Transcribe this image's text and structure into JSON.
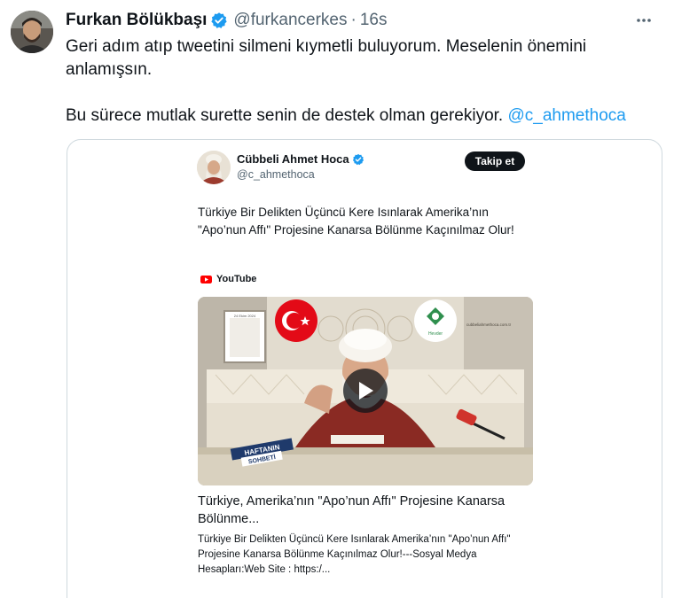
{
  "tweet": {
    "author_name": "Furkan Bölükbaşı",
    "handle": "@furkancerkes",
    "separator": "·",
    "time": "16s",
    "more_icon": "more-horizontal-icon",
    "verified_color": "#1d9bf0",
    "text_line1": "Geri adım atıp tweetini silmeni kıymetli buluyorum. Meselenin önemini anlamışsın.",
    "text_line2": "Bu sürece mutlak surette senin de destek olman gerekiyor.",
    "mention": "@c_ahmethoca",
    "mention_color": "#1d9bf0"
  },
  "embed": {
    "author_name": "Cübbeli Ahmet Hoca",
    "handle": "@c_ahmethoca",
    "follow_label": "Takip et",
    "text": "Türkiye Bir Delikten Üçüncü Kere Isınlarak Amerika’nın \"Apo’nun Affı\" Projesine Kanarsa Bölünme Kaçınılmaz Olur!",
    "source": "YouTube",
    "video": {
      "date_label": "24 Ekim 2024",
      "logo_label": "Hevder",
      "site_label": "cubbeliahmethoca.com.tr",
      "banner_line1": "HAFTANIN",
      "banner_line2": "SOHBETİ",
      "play_icon": "play-icon"
    },
    "card_title": "Türkiye, Amerika’nın \"Apo’nun Affı\" Projesine Kanarsa Bölünme...",
    "card_description": "Türkiye Bir Delikten Üçüncü Kere Isınlarak Amerika’nın \"Apo’nun Affı\" Projesine Kanarsa Bölünme Kaçınılmaz Olur!---Sosyal Medya Hesapları:Web Site : https:/..."
  }
}
